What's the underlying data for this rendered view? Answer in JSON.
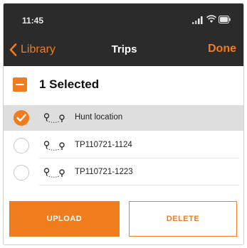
{
  "status_bar": {
    "time": "11:45"
  },
  "nav": {
    "back_label": "Library",
    "title": "Trips",
    "done_label": "Done"
  },
  "selection": {
    "label": "1 Selected"
  },
  "trips": [
    {
      "name": "Hunt location",
      "selected": true
    },
    {
      "name": "TP110721-1124",
      "selected": false
    },
    {
      "name": "TP110721-1223",
      "selected": false
    }
  ],
  "actions": {
    "upload_label": "UPLOAD",
    "delete_label": "DELETE"
  },
  "colors": {
    "accent": "#f07c1c",
    "header_bg": "#2b2b2b",
    "selected_row_bg": "#dedede"
  },
  "icons": [
    "signal-icon",
    "wifi-icon",
    "battery-icon",
    "chevron-left-icon",
    "minus-box-icon",
    "checkmark-icon",
    "route-icon"
  ]
}
